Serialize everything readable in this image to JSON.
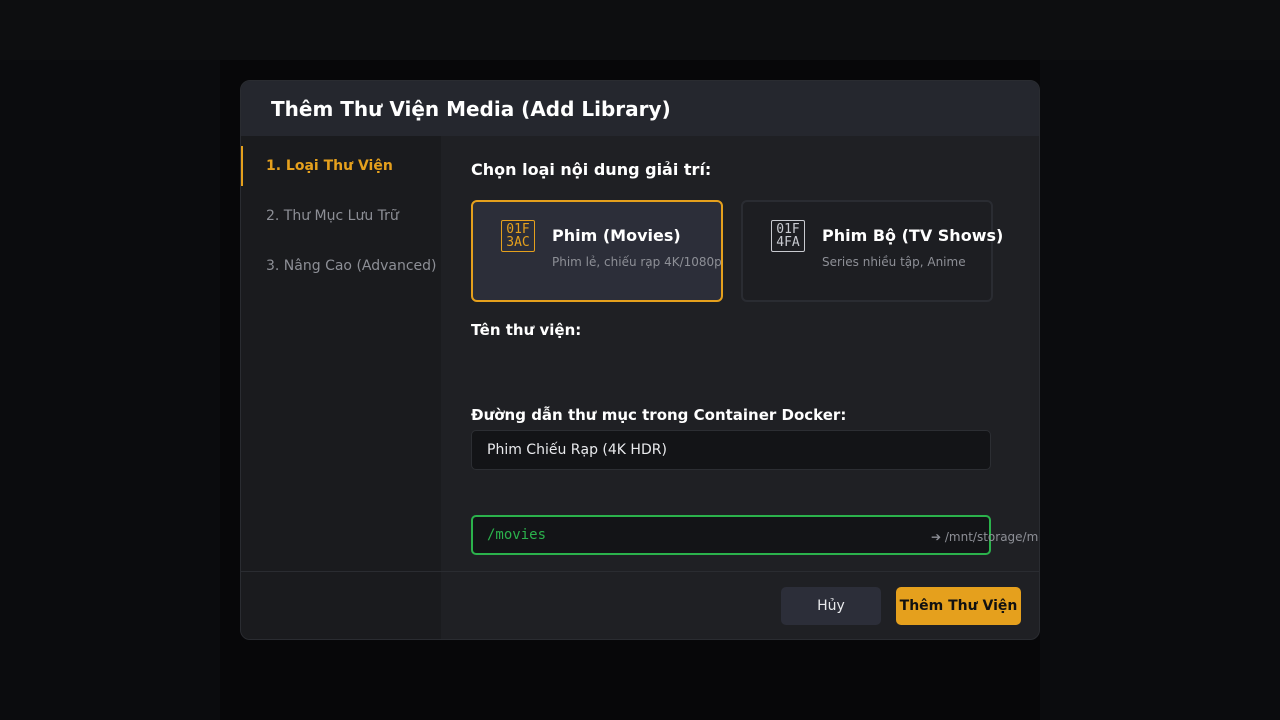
{
  "dialog": {
    "title": "Thêm Thư Viện Media (Add Library)"
  },
  "sidebar": {
    "items": [
      {
        "label": "1. Loại Thư Viện",
        "active": true
      },
      {
        "label": "2. Thư Mục Lưu Trữ",
        "active": false
      },
      {
        "label": "3. Nâng Cao (Advanced)",
        "active": false
      }
    ]
  },
  "content_type": {
    "heading": "Chọn loại nội dung giải trí:",
    "cards": [
      {
        "title": "Phim (Movies)",
        "subtitle": "Phim lẻ, chiếu rạp 4K/1080p",
        "icon": "movie-camera-icon",
        "icon_glyph_top": "01F",
        "icon_glyph_bottom": "3AC",
        "selected": true
      },
      {
        "title": "Phim Bộ (TV Shows)",
        "subtitle": "Series nhiều tập, Anime",
        "icon": "television-icon",
        "icon_glyph_top": "01F",
        "icon_glyph_bottom": "4FA",
        "selected": false
      }
    ]
  },
  "library_name": {
    "label": "Tên thư viện:",
    "value": "Phim Chiếu Rạp (4K HDR)"
  },
  "container_path": {
    "label": "Đường dẫn thư mục trong Container Docker:",
    "value": "/movies",
    "host_mapping": "➔ /mnt/storage/movies"
  },
  "footer": {
    "cancel_label": "Hủy",
    "submit_label": "Thêm Thư Viện"
  },
  "colors": {
    "accent": "#e5a01d",
    "success": "#2bb24c",
    "background": "#0b0c0e",
    "dialog_bg": "#1f2024"
  }
}
